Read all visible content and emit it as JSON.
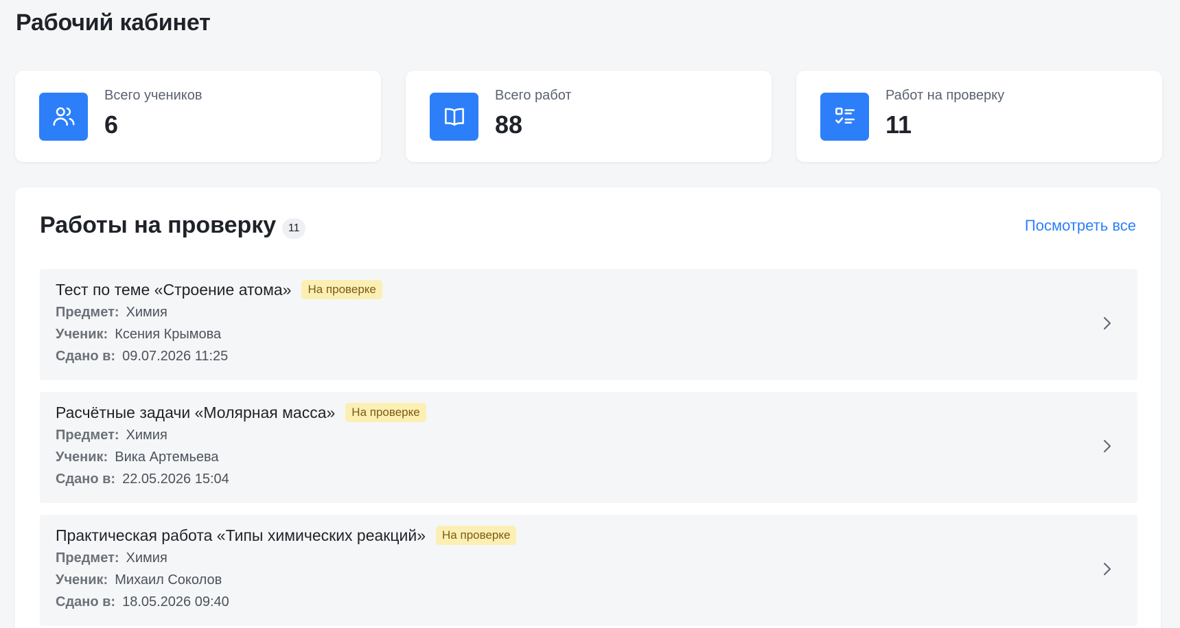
{
  "page": {
    "title": "Рабочий кабинет"
  },
  "stats": [
    {
      "icon": "users-icon",
      "label": "Всего учеников",
      "value": "6"
    },
    {
      "icon": "book-icon",
      "label": "Всего работ",
      "value": "88"
    },
    {
      "icon": "checklist-icon",
      "label": "Работ на проверку",
      "value": "11"
    }
  ],
  "review": {
    "title": "Работы на проверку",
    "count": "11",
    "view_all": "Посмотреть все",
    "subject_label": "Предмет:",
    "student_label": "Ученик:",
    "submitted_label": "Сдано в:",
    "items": [
      {
        "title": "Тест по теме «Строение атома»",
        "status": "На проверке",
        "subject": "Химия",
        "student": "Ксения Крымова",
        "submitted": "09.07.2026 11:25"
      },
      {
        "title": "Расчётные задачи «Молярная масса»",
        "status": "На проверке",
        "subject": "Химия",
        "student": "Вика Артемьева",
        "submitted": "22.05.2026 15:04"
      },
      {
        "title": "Практическая работа «Типы химических реакций»",
        "status": "На проверке",
        "subject": "Химия",
        "student": "Михаил Соколов",
        "submitted": "18.05.2026 09:40"
      }
    ]
  },
  "colors": {
    "accent": "#2d7ff9",
    "status_bg": "#fbefb4",
    "status_text": "#7b5a12",
    "page_bg": "#f5f6f8"
  }
}
